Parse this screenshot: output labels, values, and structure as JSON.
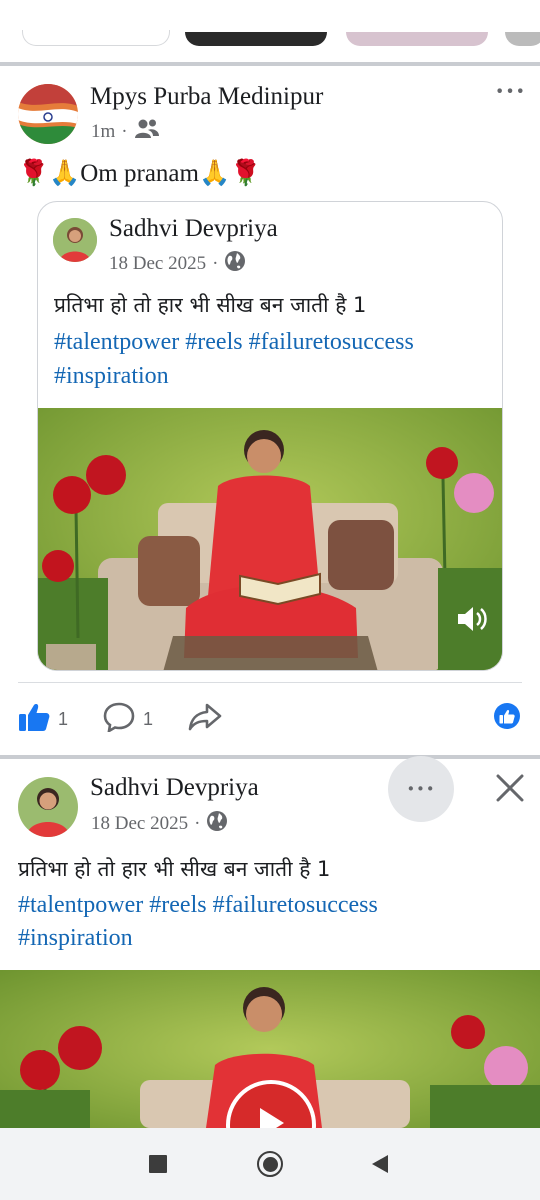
{
  "post1": {
    "author": "Mpys Purba Medinipur",
    "time": "1m",
    "text": "🌹🙏Om pranam🙏🌹",
    "reactions_count": "1",
    "comments_count": "1",
    "shared": {
      "author": "Sadhvi Devpriya",
      "date": "18 Dec 2025",
      "line1": "प्रतिभा हो तो हार भी सीख बन जाती है 1",
      "hashtags_line1": "#talentpower #reels #failuretosuccess",
      "hashtags_line2": "#inspiration"
    }
  },
  "post2": {
    "author": "Sadhvi Devpriya",
    "date": "18 Dec 2025",
    "line1": "प्रतिभा हो तो हार भी सीख बन जाती है 1",
    "hashtags_line1": "#talentpower #reels #failuretosuccess",
    "hashtags_line2": "#inspiration"
  },
  "icons": {
    "more": "more-options-icon",
    "close": "close-icon",
    "like": "like-icon",
    "comment": "comment-icon",
    "share": "share-icon",
    "friends": "friends-icon",
    "globe": "globe-icon",
    "volume": "volume-icon",
    "play": "play-icon"
  },
  "colors": {
    "link": "#1467b4",
    "like_blue": "#1877f2",
    "secondary_text": "#65676b",
    "play_red": "#d62a2a"
  }
}
